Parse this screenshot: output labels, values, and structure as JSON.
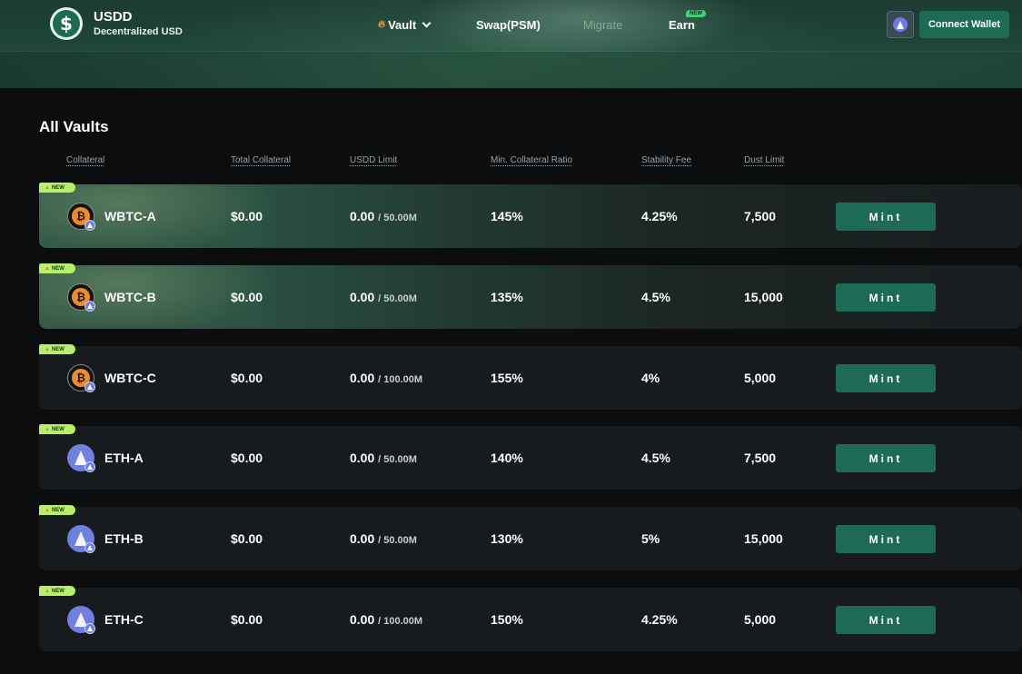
{
  "brand": {
    "title": "USDD",
    "subtitle": "Decentralized USD",
    "logo_icon": "dollar-coin-icon"
  },
  "nav": {
    "vault": "Vault",
    "swap": "Swap(PSM)",
    "migrate": "Migrate",
    "earn": "Earn",
    "earn_badge": "NEW"
  },
  "header": {
    "connect_label": "Connect Wallet",
    "network_icon": "ethereum-icon"
  },
  "colors": {
    "accent": "#1e6b55",
    "new_tag": "#b6f06b",
    "background": "#0b0d0f"
  },
  "main": {
    "title": "All Vaults",
    "columns": [
      "Collateral",
      "Total Collateral",
      "USDD Limit",
      "Min. Collateral Ratio",
      "Stability Fee",
      "Dust Limit"
    ],
    "rows": [
      {
        "tag": "NEW",
        "icon": "bitcoin-icon",
        "name": "WBTC-A",
        "total": "$0.00",
        "limit_used": "0.00",
        "limit_max": "/ 50.00M",
        "ratio": "145%",
        "fee": "4.25%",
        "dust": "7,500",
        "action": "Mint"
      },
      {
        "tag": "NEW",
        "icon": "bitcoin-icon",
        "name": "WBTC-B",
        "total": "$0.00",
        "limit_used": "0.00",
        "limit_max": "/ 50.00M",
        "ratio": "135%",
        "fee": "4.5%",
        "dust": "15,000",
        "action": "Mint"
      },
      {
        "tag": "NEW",
        "icon": "bitcoin-icon",
        "name": "WBTC-C",
        "total": "$0.00",
        "limit_used": "0.00",
        "limit_max": "/ 100.00M",
        "ratio": "155%",
        "fee": "4%",
        "dust": "5,000",
        "action": "Mint"
      },
      {
        "tag": "NEW",
        "icon": "ethereum-icon",
        "name": "ETH-A",
        "total": "$0.00",
        "limit_used": "0.00",
        "limit_max": "/ 50.00M",
        "ratio": "140%",
        "fee": "4.5%",
        "dust": "7,500",
        "action": "Mint"
      },
      {
        "tag": "NEW",
        "icon": "ethereum-icon",
        "name": "ETH-B",
        "total": "$0.00",
        "limit_used": "0.00",
        "limit_max": "/ 50.00M",
        "ratio": "130%",
        "fee": "5%",
        "dust": "15,000",
        "action": "Mint"
      },
      {
        "tag": "NEW",
        "icon": "ethereum-icon",
        "name": "ETH-C",
        "total": "$0.00",
        "limit_used": "0.00",
        "limit_max": "/ 100.00M",
        "ratio": "150%",
        "fee": "4.25%",
        "dust": "5,000",
        "action": "Mint"
      }
    ]
  }
}
